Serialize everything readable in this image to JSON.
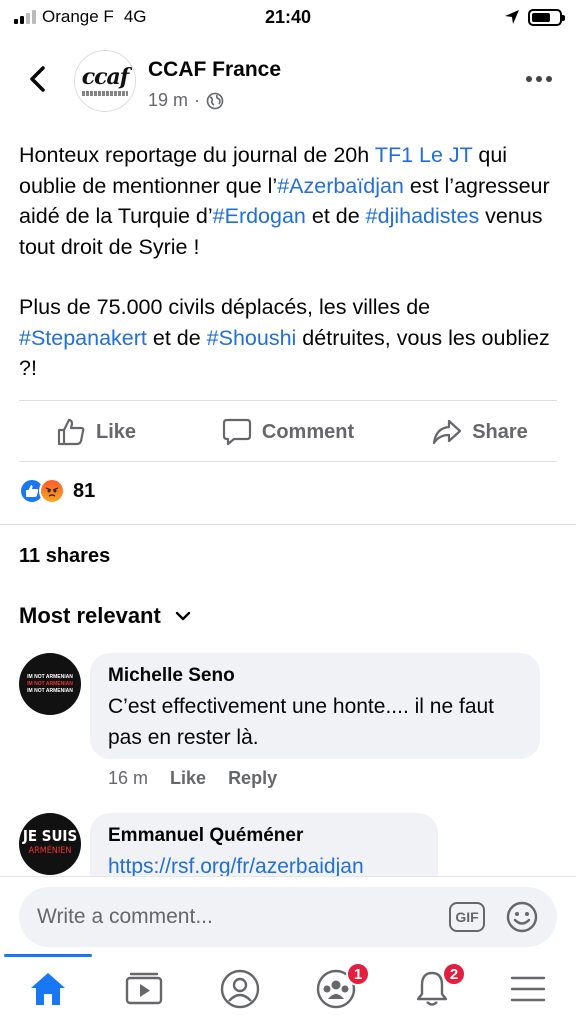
{
  "status_bar": {
    "carrier": "Orange F",
    "network": "4G",
    "time": "21:40"
  },
  "header": {
    "page_name": "CCAF France",
    "logo_text": "ccaf",
    "time_ago": "19 m",
    "separator": "·",
    "privacy_icon": "globe-icon"
  },
  "post": {
    "paragraph1": [
      {
        "text": "Honteux reportage du journal de 20h ",
        "link": false
      },
      {
        "text": "TF1 Le JT",
        "link": true
      },
      {
        "text": " qui oublie de mentionner que l’",
        "link": false
      },
      {
        "text": "#Azerbaïdjan",
        "link": true
      },
      {
        "text": " est l’agresseur aidé de la Turquie d’",
        "link": false
      },
      {
        "text": "#Erdogan",
        "link": true
      },
      {
        "text": " et de ",
        "link": false
      },
      {
        "text": "#djihadistes",
        "link": true
      },
      {
        "text": " venus tout droit de Syrie !",
        "link": false
      }
    ],
    "paragraph2": [
      {
        "text": "Plus de 75.000 civils déplacés, les villes de ",
        "link": false
      },
      {
        "text": "#Stepanakert",
        "link": true
      },
      {
        "text": " et de ",
        "link": false
      },
      {
        "text": "#Shoushi",
        "link": true
      },
      {
        "text": " détruites, vous les oubliez ?!",
        "link": false
      }
    ]
  },
  "actions": {
    "like": "Like",
    "comment": "Comment",
    "share": "Share"
  },
  "reactions": {
    "count": "81",
    "types": [
      "like-icon",
      "angry-icon"
    ]
  },
  "shares_text": "11 shares",
  "sort_label": "Most relevant",
  "comments": [
    {
      "author": "Michelle Seno",
      "text": "C’est effectivement une honte.... il ne faut pas en rester là.",
      "time": "16 m",
      "like_label": "Like",
      "reply_label": "Reply",
      "avatar_lines": [
        "IM NOT ARMENIAN",
        "IM NOT ARMENIAN",
        "IM NOT ARMENIAN"
      ]
    },
    {
      "author": "Emmanuel Quéméner",
      "text": "https://rsf.org/fr/azerbaidjan",
      "avatar_line1": "JE SUIS",
      "avatar_line2": "ARMÉNIEN"
    }
  ],
  "composer": {
    "placeholder": "Write a comment...",
    "gif_label": "GIF"
  },
  "nav": {
    "items": [
      "home-icon",
      "watch-icon",
      "profile-icon",
      "groups-icon",
      "notifications-icon",
      "menu-icon"
    ],
    "groups_badge": "1",
    "notifications_badge": "2"
  },
  "colors": {
    "accent": "#1877f2",
    "link": "#216fdb",
    "badge": "#e41e3f",
    "muted": "#65676b"
  }
}
